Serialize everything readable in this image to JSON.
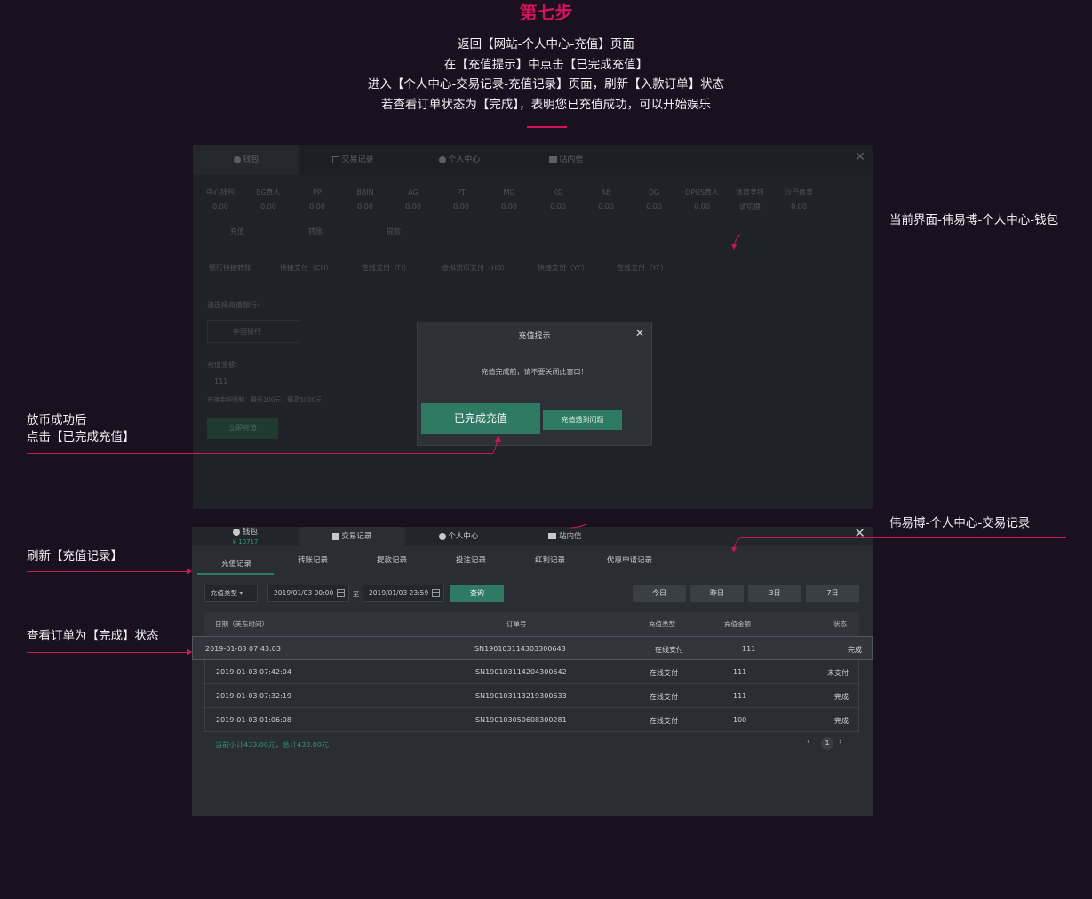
{
  "header": {
    "step_title": "第七步",
    "lines": [
      "返回【网站-个人中心-充值】页面",
      "在【充值提示】中点击【已完成充值】",
      "进入【个人中心-交易记录-充值记录】页面，刷新【入款订单】状态",
      "若查看订单状态为【完成】，表明您已充值成功，可以开始娱乐"
    ]
  },
  "annotations": {
    "top_right": "当前界面-伟易博-个人中心-钱包",
    "left_1a": "放币成功后",
    "left_1b": "点击【已完成充值】",
    "bottom_right": "伟易博-个人中心-交易记录",
    "left_2": "刷新【充值记录】",
    "left_3": "查看订单为【完成】状态"
  },
  "wallet_panel": {
    "tabs": [
      {
        "label": "钱包",
        "icon": "gear-icon"
      },
      {
        "label": "交易记录",
        "icon": "list-icon"
      },
      {
        "label": "个人中心",
        "icon": "gear-icon"
      },
      {
        "label": "站内信",
        "icon": "mail-icon"
      }
    ],
    "balances": [
      {
        "name": "中心钱包",
        "value": "0.00"
      },
      {
        "name": "EG真人",
        "value": "0.00"
      },
      {
        "name": "PP",
        "value": "0.00"
      },
      {
        "name": "BBIN",
        "value": "0.00"
      },
      {
        "name": "AG",
        "value": "0.00"
      },
      {
        "name": "PT",
        "value": "0.00"
      },
      {
        "name": "MG",
        "value": "0.00"
      },
      {
        "name": "KG",
        "value": "0.00"
      },
      {
        "name": "AB",
        "value": "0.00"
      },
      {
        "name": "DG",
        "value": "0.00"
      },
      {
        "name": "OPUS真人",
        "value": "0.00"
      },
      {
        "name": "体育竞技",
        "value": "请切换"
      },
      {
        "name": "沙巴体育",
        "value": "0.00"
      }
    ],
    "sub_tabs": [
      "充值",
      "转账",
      "提款"
    ],
    "pay_methods": [
      "银行快捷转账",
      "快捷支付（CH）",
      "在线支付（FI）",
      "虚拟货币支付（HB）",
      "快捷支付（YF）",
      "在线支付（YF）"
    ],
    "bank_label": "请选择充值银行:",
    "bank_value": "中国银行",
    "amount_label": "充值金额:",
    "amount_value": "111",
    "amount_hint": "充值金额限制：最低100元，最高5000元",
    "submit_label": "立即充值"
  },
  "modal": {
    "title": "充值提示",
    "message": "充值完成前，请不要关闭此窗口！",
    "done_button": "已完成充值",
    "issue_button": "充值遇到问题"
  },
  "records_panel": {
    "tabs": [
      {
        "label": "钱包",
        "sub": "¥ 10717",
        "icon": "gear-icon"
      },
      {
        "label": "交易记录",
        "icon": "list-icon"
      },
      {
        "label": "个人中心",
        "icon": "gear-icon"
      },
      {
        "label": "站内信",
        "icon": "mail-icon"
      }
    ],
    "sub_tabs": [
      "充值记录",
      "转账记录",
      "提款记录",
      "投注记录",
      "红利记录",
      "优惠申请记录"
    ],
    "filter": {
      "type": "充值类型 ▾",
      "start": "2019/01/03 00:00",
      "to": "至",
      "end": "2019/01/03 23:59",
      "query": "查询"
    },
    "quick": [
      "今日",
      "昨日",
      "3日",
      "7日"
    ],
    "columns": [
      "日期（美东时间）",
      "订单号",
      "充值类型",
      "充值金额",
      "状态"
    ],
    "rows": [
      {
        "date": "2019-01-03 07:43:03",
        "order": "SN190103114303300643",
        "type": "在线支付",
        "amount": "111",
        "status": "完成"
      },
      {
        "date": "2019-01-03 07:42:04",
        "order": "SN190103114204300642",
        "type": "在线支付",
        "amount": "111",
        "status": "未支付"
      },
      {
        "date": "2019-01-03 07:32:19",
        "order": "SN190103113219300633",
        "type": "在线支付",
        "amount": "111",
        "status": "完成"
      },
      {
        "date": "2019-01-03 01:06:08",
        "order": "SN190103050608300281",
        "type": "在线支付",
        "amount": "100",
        "status": "完成"
      }
    ],
    "summary": "当前小计433.00元，总计433.00元",
    "page": "1"
  }
}
